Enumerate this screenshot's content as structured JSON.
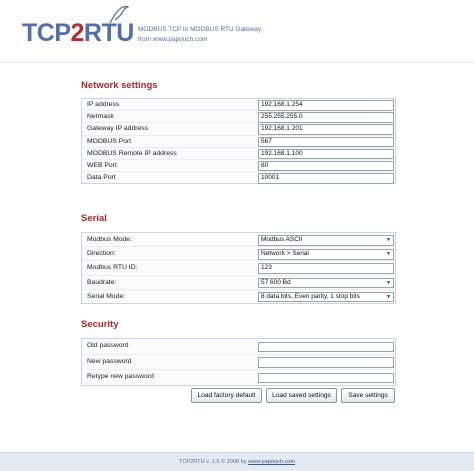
{
  "header": {
    "logo_left": "TCP",
    "logo_mid": "2",
    "logo_right": "RTU",
    "tagline_line1": "MODBUS TCP to MODBUS RTU Gateway",
    "tagline_line2": "from www.papouch.com"
  },
  "network": {
    "title": "Network settings",
    "rows": [
      {
        "label": "IP address",
        "value": "192.168.1.254"
      },
      {
        "label": "Netmask",
        "value": "255.255.255.0"
      },
      {
        "label": "Gateway IP address",
        "value": "192.168.1.201"
      },
      {
        "label": "MODBUS Port",
        "value": "567"
      },
      {
        "label": "MODBUS Remote IP address",
        "value": "192.168.1.100"
      },
      {
        "label": "WEB Port",
        "value": "80"
      },
      {
        "label": "Data Port",
        "value": "10001"
      }
    ]
  },
  "serial": {
    "title": "Serial",
    "rows": [
      {
        "label": "Modbus Mode:",
        "value": "Modbus ASCII",
        "kind": "select"
      },
      {
        "label": "Direction:",
        "value": "Network > Serial",
        "kind": "select"
      },
      {
        "label": "Modbus RTU ID:",
        "value": "123",
        "kind": "input"
      },
      {
        "label": "Baudrate:",
        "value": "57 600 Bd",
        "kind": "select"
      },
      {
        "label": "Serial Mode:",
        "value": "8 data bits, Even parity, 1 stop bits",
        "kind": "select"
      }
    ]
  },
  "security": {
    "title": "Security",
    "rows": [
      {
        "label": "Old password",
        "value": ""
      },
      {
        "label": "New password",
        "value": ""
      },
      {
        "label": "Retype new password",
        "value": ""
      }
    ]
  },
  "buttons": {
    "factory": "Load factory default",
    "saved": "Load saved settings",
    "save": "Save settings"
  },
  "footer": {
    "prefix": "TCP2RTU v. 1.5 © 2008 by ",
    "link": "www.papouch.com"
  },
  "colors": {
    "brand_blue": "#4f6fae",
    "brand_red": "#c1262c",
    "section_title": "#b8252a"
  }
}
